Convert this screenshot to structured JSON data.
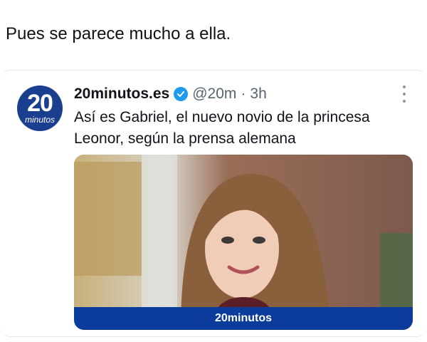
{
  "caption": "Pues se parece mucho a ella.",
  "tweet": {
    "avatar": {
      "number": "20",
      "word": "minutos"
    },
    "display_name": "20minutos.es",
    "handle": "@20m",
    "separator": "·",
    "time": "3h",
    "text": "Así es Gabriel, el nuevo novio de la princesa Leonor, según la prensa alemana",
    "media": {
      "banner": "20minutos"
    }
  },
  "colors": {
    "brand_blue": "#0b3c9c",
    "verified_blue": "#1d9bf0",
    "muted_text": "#536471"
  }
}
